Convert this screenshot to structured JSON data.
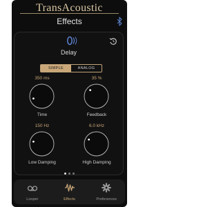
{
  "app": {
    "brand": "TransAcoustic",
    "screen_title": "Effects"
  },
  "effect": {
    "name": "Delay"
  },
  "mode_toggle": {
    "options": [
      "SIMPLE",
      "ANALOG"
    ],
    "selected": "SIMPLE"
  },
  "knobs": [
    {
      "value": "350 ms",
      "label": "Time",
      "level": 0.15
    },
    {
      "value": "35 %",
      "label": "Feedback",
      "level": 0.35
    },
    {
      "value": "150 Hz",
      "label": "Low Damping",
      "level": 0.25
    },
    {
      "value": "6.0 kHz",
      "label": "High Damping",
      "level": 0.3
    }
  ],
  "pager": {
    "count": 3,
    "active_index": 0
  },
  "tabs": [
    {
      "label": "Looper",
      "icon": "cassette-icon",
      "active": false
    },
    {
      "label": "Effects",
      "icon": "waveform-icon",
      "active": true
    },
    {
      "label": "Preferences",
      "icon": "gear-icon",
      "active": false
    }
  ],
  "colors": {
    "accent": "#c9a778",
    "background": "#0d0d0d",
    "text": "#cfcfcf"
  }
}
